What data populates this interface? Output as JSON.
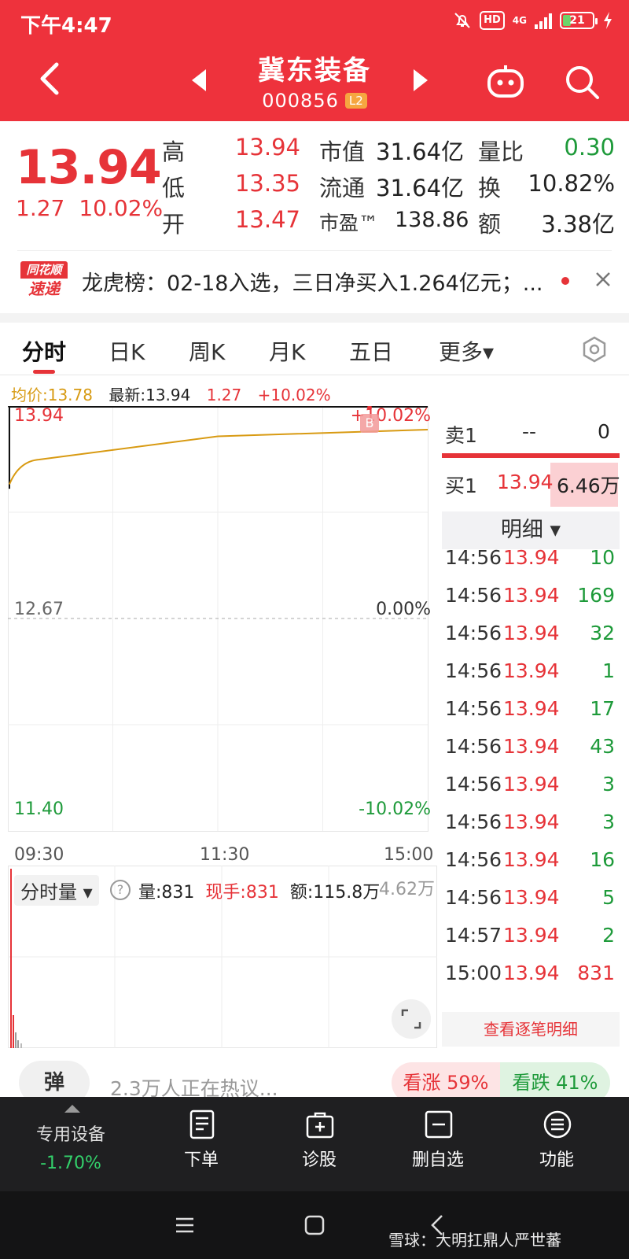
{
  "status": {
    "time": "下午4:47",
    "hd": "HD",
    "network": "4G",
    "battery": "21"
  },
  "header": {
    "stock_name": "冀东装备",
    "stock_code": "000856",
    "level_badge": "L2"
  },
  "quote": {
    "price": "13.94",
    "change": "1.27",
    "change_pct": "10.02%",
    "rows": [
      {
        "l1": "高",
        "v1": "13.94",
        "l2": "市值",
        "v2": "31.64亿",
        "l3": "量比",
        "v3": "0.30"
      },
      {
        "l1": "低",
        "v1": "13.35",
        "l2": "流通",
        "v2": "31.64亿",
        "l3": "换",
        "v3": "10.82%"
      },
      {
        "l1": "开",
        "v1": "13.47",
        "l2": "市盈™",
        "v2": "138.86",
        "l3": "额",
        "v3": "3.38亿"
      }
    ]
  },
  "news": {
    "logo_top": "同花顺",
    "logo_bottom": "速递",
    "text": "龙虎榜：02-18入选，三日净买入1.264亿元；..."
  },
  "tabs": [
    "分时",
    "日K",
    "周K",
    "月K",
    "五日",
    "更多▾"
  ],
  "legend": {
    "avg": "均价:13.78",
    "latest": "最新:13.94",
    "chg": "1.27",
    "pct": "+10.02%"
  },
  "chart": {
    "price_top": "13.94",
    "price_mid": "12.67",
    "price_bottom": "11.40",
    "pct_top": "+10.02%",
    "pct_mid": "0.00%",
    "pct_bottom": "-10.02%",
    "times": [
      "09:30",
      "11:30",
      "15:00"
    ],
    "b_marker": "B"
  },
  "chart_data": {
    "type": "line",
    "title": "",
    "xlabel": "",
    "ylabel": "",
    "x": [
      "09:30",
      "11:30",
      "15:00"
    ],
    "ylim": [
      11.4,
      13.94
    ],
    "series": [
      {
        "name": "均价",
        "values": [
          13.62,
          13.74,
          13.78
        ]
      },
      {
        "name": "最新",
        "values": [
          13.94,
          13.94,
          13.94
        ]
      }
    ],
    "color_avg": "#d89a12",
    "color_price": "#111111"
  },
  "book": {
    "sell1": {
      "label": "卖1",
      "price": "--",
      "vol": "0"
    },
    "buy1": {
      "label": "买1",
      "price": "13.94",
      "vol": "6.46万"
    },
    "detail_header": "明细 ▾",
    "ticks": [
      {
        "t": "14:56",
        "p": "13.94",
        "v": "10"
      },
      {
        "t": "14:56",
        "p": "13.94",
        "v": "169"
      },
      {
        "t": "14:56",
        "p": "13.94",
        "v": "32"
      },
      {
        "t": "14:56",
        "p": "13.94",
        "v": "1"
      },
      {
        "t": "14:56",
        "p": "13.94",
        "v": "17"
      },
      {
        "t": "14:56",
        "p": "13.94",
        "v": "43"
      },
      {
        "t": "14:56",
        "p": "13.94",
        "v": "3"
      },
      {
        "t": "14:56",
        "p": "13.94",
        "v": "3"
      },
      {
        "t": "14:56",
        "p": "13.94",
        "v": "16"
      },
      {
        "t": "14:56",
        "p": "13.94",
        "v": "5"
      },
      {
        "t": "14:57",
        "p": "13.94",
        "v": "2"
      },
      {
        "t": "15:00",
        "p": "13.94",
        "v": "831"
      }
    ],
    "more": "查看逐笔明细"
  },
  "volume": {
    "select": "分时量 ▾",
    "help": "?",
    "qty": "量:831",
    "now": "现手:831",
    "amount": "额:115.8万",
    "max": "4.62万"
  },
  "hot": {
    "dan": "弹",
    "text": "2.3万人正在热议...",
    "bull": "看涨 59%",
    "bear": "看跌 41%"
  },
  "toolbar": {
    "special_label": "专用设备",
    "special_value": "-1.70%",
    "items": [
      "下单",
      "诊股",
      "删自选",
      "功能"
    ]
  },
  "watermark": "雪球：大明扛鼎人严世蕃"
}
